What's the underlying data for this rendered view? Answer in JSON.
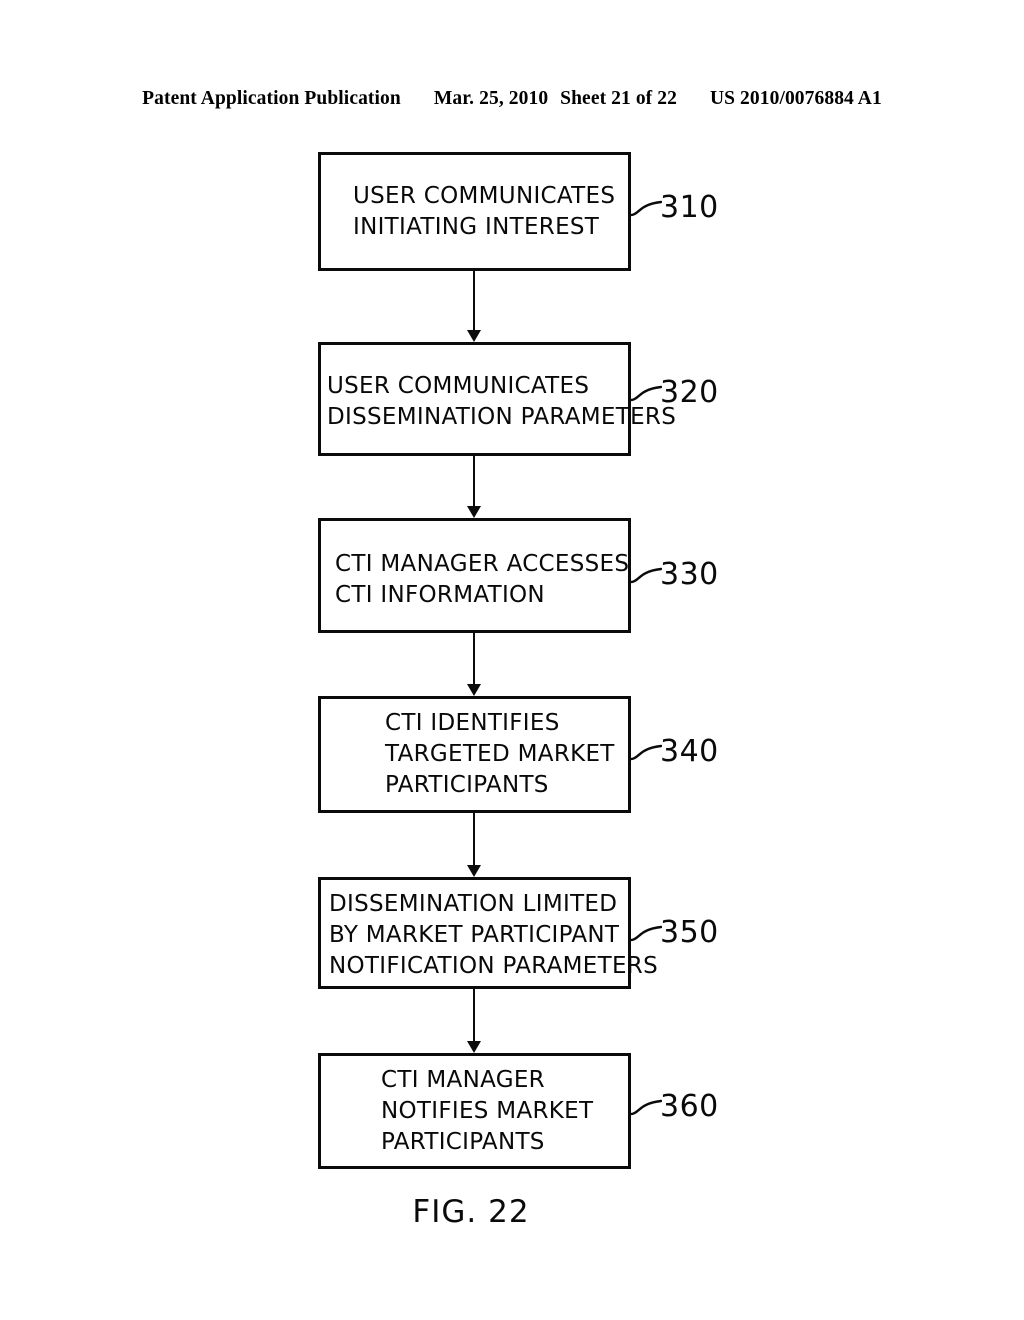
{
  "header": {
    "publication": "Patent Application Publication",
    "date": "Mar. 25, 2010",
    "sheet": "Sheet 21 of 22",
    "document_number": "US 2010/0076884 A1"
  },
  "figure": {
    "caption": "FIG. 22",
    "colors": {
      "ink": "#0b0b0b",
      "paper": "#ffffff"
    }
  },
  "flowchart": {
    "type": "flowchart",
    "orientation": "vertical",
    "steps": [
      {
        "ref": "310",
        "lines": [
          "USER COMMUNICATES",
          "INITIATING INTEREST"
        ],
        "text": "USER COMMUNICATES INITIATING INTEREST"
      },
      {
        "ref": "320",
        "lines": [
          "USER COMMUNICATES",
          "DISSEMINATION PARAMETERS"
        ],
        "text": "USER COMMUNICATES DISSEMINATION PARAMETERS"
      },
      {
        "ref": "330",
        "lines": [
          "CTI MANAGER ACCESSES",
          "CTI INFORMATION"
        ],
        "text": "CTI MANAGER ACCESSES CTI INFORMATION"
      },
      {
        "ref": "340",
        "lines": [
          "CTI IDENTIFIES",
          "TARGETED MARKET",
          "PARTICIPANTS"
        ],
        "text": "CTI IDENTIFIES TARGETED MARKET PARTICIPANTS"
      },
      {
        "ref": "350",
        "lines": [
          "DISSEMINATION LIMITED",
          "BY MARKET PARTICIPANT",
          "NOTIFICATION PARAMETERS"
        ],
        "text": "DISSEMINATION LIMITED BY MARKET PARTICIPANT NOTIFICATION PARAMETERS"
      },
      {
        "ref": "360",
        "lines": [
          "CTI MANAGER",
          "NOTIFIES MARKET",
          "PARTICIPANTS"
        ],
        "text": "CTI MANAGER NOTIFIES MARKET PARTICIPANTS"
      }
    ],
    "connectors": [
      {
        "from": "310",
        "to": "320"
      },
      {
        "from": "320",
        "to": "330"
      },
      {
        "from": "330",
        "to": "340"
      },
      {
        "from": "340",
        "to": "350"
      },
      {
        "from": "350",
        "to": "360"
      }
    ]
  }
}
